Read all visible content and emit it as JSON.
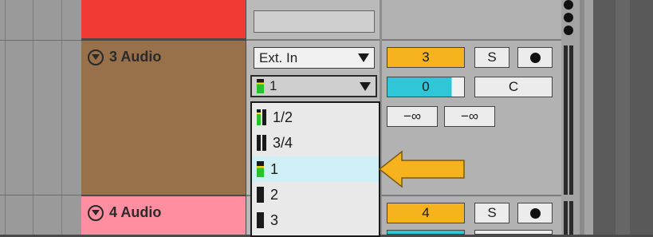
{
  "tracks": [
    {
      "name": "3 Audio",
      "color": "#98704a",
      "input_type": "Ext. In",
      "input_channel": "1",
      "track_number": "3",
      "solo_label": "S",
      "volume": "0",
      "pan": "C",
      "send_a": "−∞",
      "send_b": "−∞"
    },
    {
      "name": "4 Audio",
      "color": "#ff8fa0",
      "track_number": "4",
      "solo_label": "S"
    }
  ],
  "top_clip_color": "#f23a35",
  "popup": {
    "items": [
      {
        "label": "1/2",
        "highlighted": false
      },
      {
        "label": "3/4",
        "highlighted": false
      },
      {
        "label": "1",
        "highlighted": true
      },
      {
        "label": "2",
        "highlighted": false
      },
      {
        "label": "3",
        "highlighted": false
      }
    ]
  },
  "colors": {
    "track_number_bg": "#f6b31d",
    "volume_fill": "#2fc6d8",
    "arrow": "#f6b31d"
  }
}
